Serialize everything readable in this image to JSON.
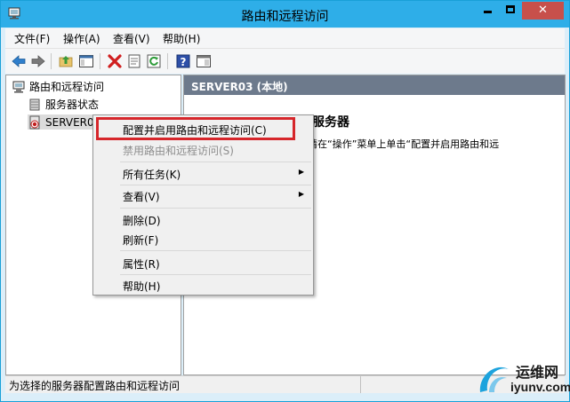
{
  "window": {
    "title": "路由和远程访问",
    "accent": "#2eaee8",
    "close_color": "#c7504b"
  },
  "menubar": [
    {
      "label": "文件(F)"
    },
    {
      "label": "操作(A)"
    },
    {
      "label": "查看(V)"
    },
    {
      "label": "帮助(H)"
    }
  ],
  "toolbar": {
    "buttons": [
      "back-arrow-icon",
      "forward-arrow-icon",
      "up-folder-icon",
      "console-tree-icon",
      "delete-icon",
      "properties-icon",
      "refresh-icon",
      "help-icon",
      "view-icon"
    ]
  },
  "tree": {
    "root": "路由和远程访问",
    "server_status": "服务器状态",
    "server": "SERVER03 (本地)"
  },
  "right_pane": {
    "header": "SERVER03 (本地)",
    "heading": "配置路由和远程访问服务器",
    "text": "要设置路由和远程访问，请在“操作”菜单上单击“配置并启用路由和远"
  },
  "context_menu": {
    "items": [
      {
        "label": "配置并启用路由和远程访问(C)",
        "disabled": false
      },
      {
        "label": "禁用路由和远程访问(S)",
        "disabled": true
      },
      {
        "label": "所有任务(K)",
        "submenu": true
      },
      {
        "label": "查看(V)",
        "submenu": true
      },
      {
        "label": "删除(D)"
      },
      {
        "label": "刷新(F)"
      },
      {
        "label": "属性(R)"
      },
      {
        "label": "帮助(H)"
      }
    ],
    "highlight_color": "#d6262b"
  },
  "statusbar": {
    "text": "为选择的服务器配置路由和远程访问"
  },
  "watermark": {
    "cn": "运维网",
    "url": "iyunv.com"
  }
}
